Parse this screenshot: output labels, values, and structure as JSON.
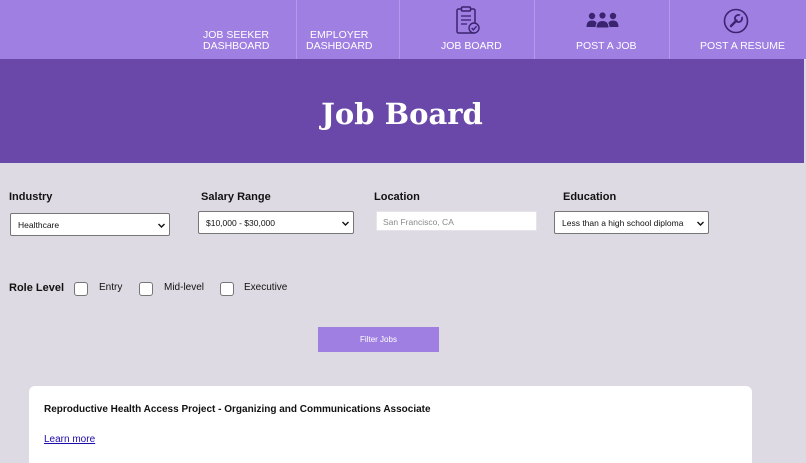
{
  "nav": {
    "items": [
      {
        "line1": "JOB SEEKER",
        "line2": "DASHBOARD"
      },
      {
        "line1": "EMPLOYER",
        "line2": "DASHBOARD"
      },
      {
        "label": "JOB BOARD",
        "icon": "clipboard-check-icon"
      },
      {
        "label": "POST A JOB",
        "icon": "people-group-icon"
      },
      {
        "label": "POST A RESUME",
        "icon": "wrench-icon"
      }
    ]
  },
  "hero": {
    "title": "Job Board"
  },
  "filters": {
    "industry": {
      "label": "Industry",
      "value": "Healthcare"
    },
    "salary": {
      "label": "Salary Range",
      "value": "$10,000 - $30,000"
    },
    "location": {
      "label": "Location",
      "placeholder": "San Francisco, CA"
    },
    "education": {
      "label": "Education",
      "value": "Less than a high school diploma"
    },
    "role_level": {
      "label": "Role Level",
      "options": [
        {
          "label": "Entry",
          "checked": false
        },
        {
          "label": "Mid-level",
          "checked": false
        },
        {
          "label": "Executive",
          "checked": false
        }
      ]
    },
    "submit_label": "Filter Jobs"
  },
  "jobs": [
    {
      "title": "Reproductive Health Access Project - Organizing and Communications Associate",
      "link_label": "Learn more"
    }
  ],
  "colors": {
    "nav_bg": "#a07fe3",
    "hero_bg": "#6a48a9",
    "page_bg": "#dedae3",
    "icon": "#3a2470"
  }
}
